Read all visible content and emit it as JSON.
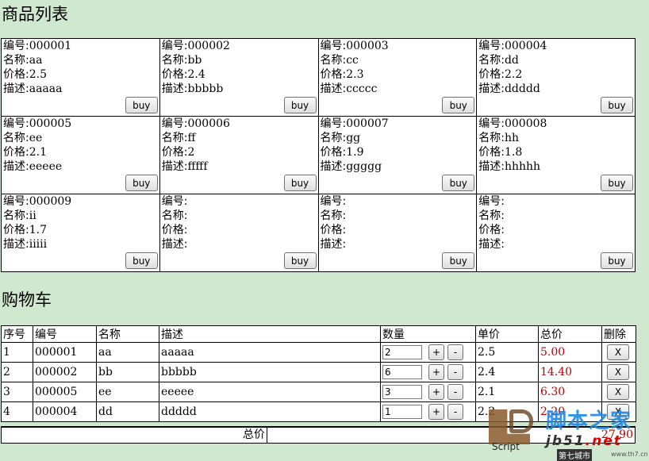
{
  "product_section": {
    "title": "商品列表",
    "labels": {
      "id": "编号:",
      "name": "名称:",
      "price": "价格:",
      "desc": "描述:"
    },
    "buy_label": "buy",
    "items": [
      {
        "id": "000001",
        "name": "aa",
        "price": "2.5",
        "desc": "aaaaa"
      },
      {
        "id": "000002",
        "name": "bb",
        "price": "2.4",
        "desc": "bbbbb"
      },
      {
        "id": "000003",
        "name": "cc",
        "price": "2.3",
        "desc": "ccccc"
      },
      {
        "id": "000004",
        "name": "dd",
        "price": "2.2",
        "desc": "ddddd"
      },
      {
        "id": "000005",
        "name": "ee",
        "price": "2.1",
        "desc": "eeeee"
      },
      {
        "id": "000006",
        "name": "ff",
        "price": "2",
        "desc": "fffff"
      },
      {
        "id": "000007",
        "name": "gg",
        "price": "1.9",
        "desc": "ggggg"
      },
      {
        "id": "000008",
        "name": "hh",
        "price": "1.8",
        "desc": "hhhhh"
      },
      {
        "id": "000009",
        "name": "ii",
        "price": "1.7",
        "desc": "iiiii"
      },
      {
        "id": "",
        "name": "",
        "price": "",
        "desc": ""
      },
      {
        "id": "",
        "name": "",
        "price": "",
        "desc": ""
      },
      {
        "id": "",
        "name": "",
        "price": "",
        "desc": ""
      }
    ]
  },
  "cart_section": {
    "title": "购物车",
    "headers": {
      "index": "序号",
      "id": "编号",
      "name": "名称",
      "desc": "描述",
      "qty": "数量",
      "unit_price": "单价",
      "total": "总价",
      "delete": "删除"
    },
    "plus_label": "+",
    "minus_label": "-",
    "delete_label": "X",
    "rows": [
      {
        "index": "1",
        "id": "000001",
        "name": "aa",
        "desc": "aaaaa",
        "qty": "2",
        "unit_price": "2.5",
        "total": "5.00"
      },
      {
        "index": "2",
        "id": "000002",
        "name": "bb",
        "desc": "bbbbb",
        "qty": "6",
        "unit_price": "2.4",
        "total": "14.40"
      },
      {
        "index": "3",
        "id": "000005",
        "name": "ee",
        "desc": "eeeee",
        "qty": "3",
        "unit_price": "2.1",
        "total": "6.30"
      },
      {
        "index": "4",
        "id": "000004",
        "name": "dd",
        "desc": "ddddd",
        "qty": "1",
        "unit_price": "2.2",
        "total": "2.20"
      }
    ],
    "summary_label": "总价",
    "summary_value": "27.90"
  },
  "watermark": {
    "script_text": "Script",
    "site_cn": "脚本之家",
    "url_pre": "jb51",
    "url_post": ".net",
    "badge": "第七城市",
    "small": "www.th7.cn"
  },
  "colors": {
    "background": "#cfe8cf",
    "total_red": "#c00000"
  }
}
